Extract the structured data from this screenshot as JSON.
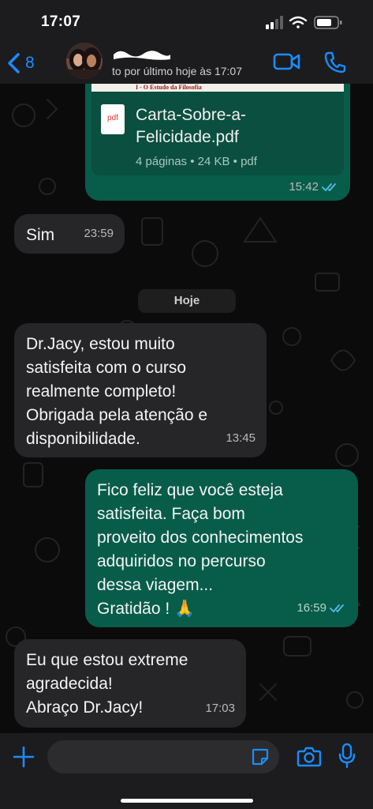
{
  "status_bar": {
    "time": "17:07"
  },
  "header": {
    "back_count": "8",
    "last_seen": "to por último hoje às 17:07"
  },
  "document": {
    "preview_heading": "I - O Estudo da Filosofia",
    "icon_label": "pdf",
    "name": "Carta-Sobre-a-Felicidade.pdf",
    "details": "4 páginas • 24 KB • pdf",
    "time": "15:42"
  },
  "messages": [
    {
      "direction": "in",
      "text": "Sim",
      "time": "23:59"
    },
    {
      "direction": "in",
      "text": "Dr.Jacy, estou muito\nsatisfeita com o curso\nrealmente completo!\nObrigada pela atenção e\ndisponibilidade.",
      "time": "13:45"
    },
    {
      "direction": "out",
      "text": "Fico feliz que você esteja\nsatisfeita.  Faça bom\nproveito dos conhecimentos\nadquiridos no percurso\ndessa viagem...\nGratidão ! 🙏",
      "time": "16:59"
    },
    {
      "direction": "in",
      "text": "Eu que estou extreme\nagradecida!\nAbraço Dr.Jacy!",
      "time": "17:03"
    }
  ],
  "date_divider": "Hoje",
  "colors": {
    "accent": "#1a8cff",
    "outgoing_bubble": "#075d4a",
    "incoming_bubble": "#262628",
    "read_ticks": "#53bdeb"
  },
  "icons": {
    "back": "chevron-left-icon",
    "video": "video-camera-icon",
    "call": "phone-icon",
    "attach": "plus-icon",
    "sticker": "sticker-icon",
    "camera": "camera-icon",
    "mic": "microphone-icon"
  }
}
